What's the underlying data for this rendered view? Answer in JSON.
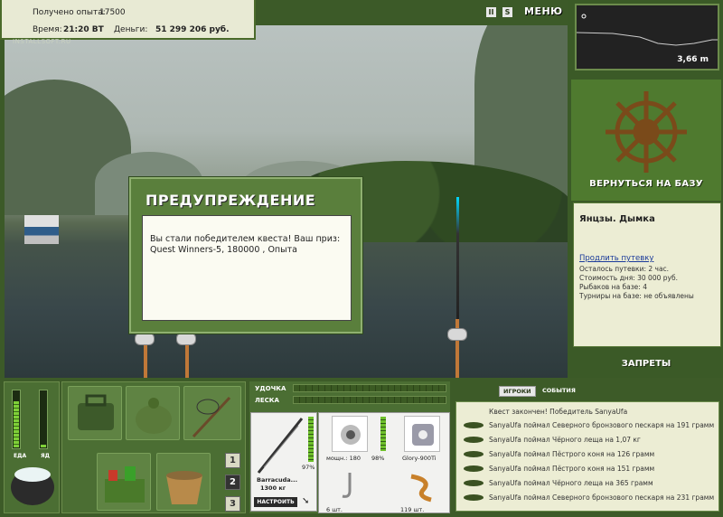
{
  "top_info": {
    "exp_label": "Получено опыта:",
    "exp_value": "17500",
    "time_label": "Время:",
    "time_value": "21:20 ВТ",
    "money_label": "Деньги:",
    "money_value": "51 299 206 руб."
  },
  "watermark": "INSTALLSOFT.RU",
  "menu": {
    "label": "МЕНЮ",
    "icon_pause": "pause-icon",
    "icon_settings": "settings-icon"
  },
  "depth": {
    "value": "3,66 m"
  },
  "base": {
    "return_label": "ВЕРНУТЬСЯ НА БАЗУ",
    "location": "Янцзы. Дымка",
    "extend_link": "Продлить путевку",
    "lines": [
      "Осталось путевки: 2 час.",
      "Стоимость дня: 30 000 руб.",
      "Рыбаков на базе: 4",
      "Турниры на базе: не объявлены"
    ],
    "bans_label": "ЗАПРЕТЫ"
  },
  "status": {
    "food_label": "ЕДА",
    "poison_label": "ЯД",
    "food_level": 0.8,
    "poison_level": 0.05
  },
  "slots": {
    "numbers": [
      "1",
      "2",
      "3"
    ],
    "active": "2"
  },
  "tackle": {
    "rod_label": "УДОЧКА",
    "line_label": "ЛЕСКА",
    "rod_name": "Barracuda...",
    "rod_weight": "1300 кг",
    "rod_percent": "97%",
    "reel_power": "мощн.: 180",
    "reel_percent": "98%",
    "line_name": "Glory-900Ti",
    "hooks_count": "6 шт.",
    "bait_count": "119 шт.",
    "setup_label": "НАСТРОИТЬ"
  },
  "log": {
    "tab_players": "ИГРОКИ",
    "tab_events": "СОБЫТИЯ",
    "lines": [
      "Квест закончен! Победитель SanyaUfa",
      "SanyaUfa поймал Северного бронзового пескаря на 191 грамм",
      "SanyaUfa поймал Чёрного леща на 1,07 кг",
      "SanyaUfa поймал Пёстрого коня на 126 грамм",
      "SanyaUfa поймал Пёстрого коня на 151 грамм",
      "SanyaUfa поймал Чёрного леща на 365 грамм",
      "SanyaUfa поймал Северного бронзового пескаря на 231 грамм"
    ]
  },
  "dialog": {
    "title": "ПРЕДУПРЕЖДЕНИЕ",
    "message": "Вы стали победителем квеста! Ваш приз: Quest Winners-5, 180000 , Опыта"
  }
}
